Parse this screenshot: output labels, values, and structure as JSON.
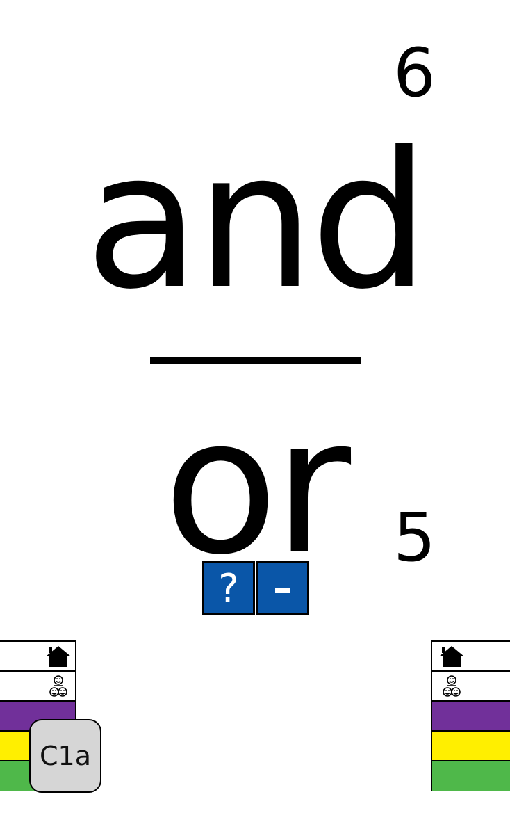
{
  "card": {
    "word_top": "and",
    "word_bottom": "or",
    "number_top": "6",
    "number_bottom": "5"
  },
  "buttons": {
    "help_label": "?",
    "minus_label": "–"
  },
  "side_panels": {
    "home_icon": "home-icon",
    "group_icon": "group-smileys-icon",
    "colors": [
      "#71309a",
      "#ffef00",
      "#4fb84a"
    ]
  },
  "badge": {
    "label": "C1a"
  }
}
